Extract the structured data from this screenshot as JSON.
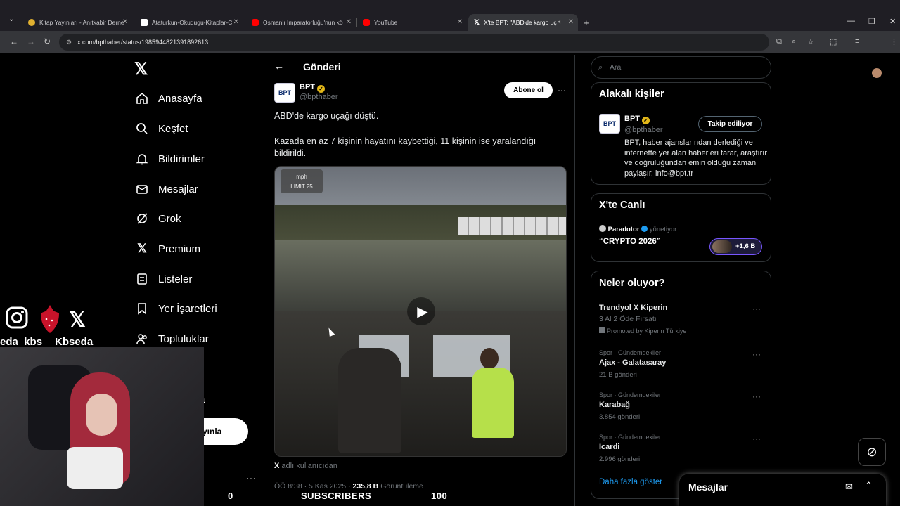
{
  "browser": {
    "tabs": [
      {
        "label": "Kitap Yayınları - Anıtkabir Derne",
        "color": "#e0b030"
      },
      {
        "label": "Ataturkun-Okudugu-Kitaplar-C",
        "color": "#ffffff"
      },
      {
        "label": "Osmanlı İmparatorluğu'nun kö",
        "color": "#ff0000"
      },
      {
        "label": "YouTube",
        "color": "#ff0000"
      },
      {
        "label": "X'te BPT: \"ABD'de kargo uç",
        "color": "#ffffff"
      }
    ],
    "url": "x.com/bpthaber/status/1985944821391892613"
  },
  "nav": {
    "items": [
      "Anasayfa",
      "Keşfet",
      "Bildirimler",
      "Mesajlar",
      "Grok",
      "Premium",
      "Listeler",
      "Yer İşaretleri",
      "Topluluklar"
    ],
    "partial_item": "a",
    "post_button": "yınla"
  },
  "post": {
    "header": "Gönderi",
    "author_name": "BPT",
    "author_handle": "@bpthaber",
    "avatar_text": "BPT",
    "subscribe": "Abone ol",
    "text1": "ABD'de kargo uçağı düştü.",
    "text2": "Kazada en az 7 kişinin hayatını kaybettiği, 11 kişinin ise yaralandığı bildirildi.",
    "video_overlay_unit": "mph",
    "video_overlay_limit": "LIMIT 25",
    "credit_x": "X",
    "credit": "adlı kullanıcıdan",
    "time": "ÖÖ 8:38 · 5 Kas 2025 · ",
    "views_count": "235,8 B",
    "views_label": "Görüntüleme"
  },
  "right": {
    "search_placeholder": "Ara",
    "related_title": "Alakalı kişiler",
    "related_name": "BPT",
    "related_handle": "@bpthaber",
    "related_follow": "Takip ediliyor",
    "related_bio": "BPT, haber ajanslarından derlediği ve internette yer alan haberleri tarar, araştırır ve doğruluğundan emin olduğu zaman paylaşır. info@bpt.tr",
    "live_title": "X'te Canlı",
    "live_host": "Paradotor",
    "live_role": "yönetiyor",
    "live_topic": "“CRYPTO 2026”",
    "live_count": "+1,6 B",
    "trends_title": "Neler oluyor?",
    "trends": [
      {
        "cat": "",
        "name": "Trendyol X Kiperin",
        "sub": "3 Al 2 Öde Fırsatı",
        "extra": "Promoted by Kiperin Türkiye"
      },
      {
        "cat": "Spor · Gündemdekiler",
        "name": "Ajax - Galatasaray",
        "sub": "21 B gönderi",
        "extra": ""
      },
      {
        "cat": "Spor · Gündemdekiler",
        "name": "Karabağ",
        "sub": "3.854 gönderi",
        "extra": ""
      },
      {
        "cat": "Spor · Gündemdekiler",
        "name": "Icardi",
        "sub": "2.996 gönderi",
        "extra": ""
      }
    ],
    "show_more": "Daha fazla göster",
    "messages": "Mesajlar"
  },
  "stream": {
    "instagram": "eda_kbs",
    "twitter": "Kbseda_",
    "left_count": "0",
    "subscribers_label": "SUBSCRIBERS",
    "right_count": "100"
  }
}
